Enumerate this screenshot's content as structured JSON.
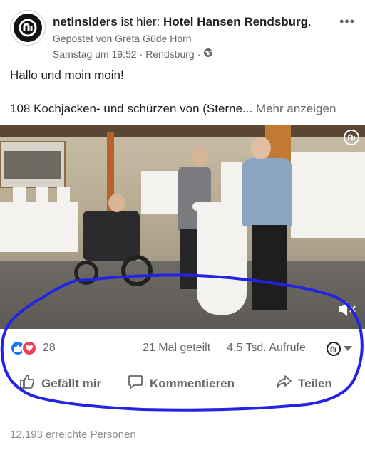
{
  "post": {
    "page_name": "netinsiders",
    "checkin_text": "ist hier:",
    "location_name": "Hotel Hansen Rendsburg",
    "title_suffix": ".",
    "posted_by": "Gepostet von Greta Güde Horn",
    "timestamp": "Samstag um 19:52",
    "separator": "·",
    "place": "Rendsburg",
    "separator2": "·",
    "privacy_icon": "globe-icon",
    "more_icon": "•••",
    "greeting": "Hallo und moin moin!",
    "body_text": "108 Kochjacken- und schürzen von (Sterne...",
    "show_more": "Mehr anzeigen"
  },
  "stats": {
    "reaction_count": "28",
    "shares": "21 Mal geteilt",
    "views": "4,5 Tsd. Aufrufe"
  },
  "actions": {
    "like_label": "Gefällt mir",
    "comment_label": "Kommentieren",
    "share_label": "Teilen"
  },
  "footer": {
    "reach": "12.193 erreichte Personen"
  },
  "colors": {
    "facebook_blue": "#1877f2",
    "love_red": "#f33e58",
    "annotation_blue": "#2323e6",
    "secondary_text": "#65676b"
  }
}
